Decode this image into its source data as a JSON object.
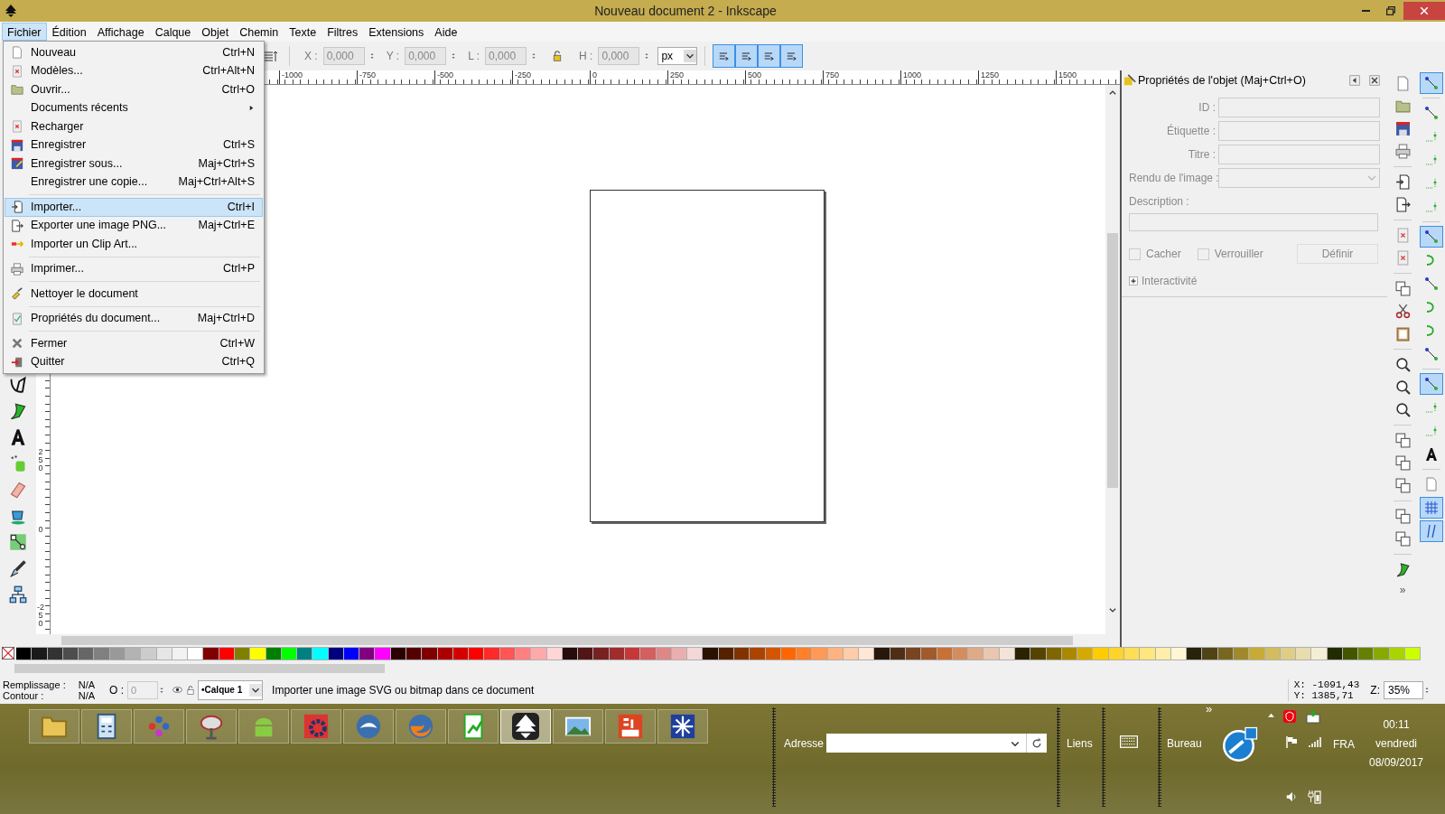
{
  "window": {
    "title": "Nouveau document 2 - Inkscape"
  },
  "menu_bar": [
    {
      "label": "Fichier",
      "selected": true
    },
    {
      "label": "Édition",
      "selected": false
    },
    {
      "label": "Affichage",
      "selected": false
    },
    {
      "label": "Calque",
      "selected": false
    },
    {
      "label": "Objet",
      "selected": false
    },
    {
      "label": "Chemin",
      "selected": false
    },
    {
      "label": "Texte",
      "selected": false
    },
    {
      "label": "Filtres",
      "selected": false
    },
    {
      "label": "Extensions",
      "selected": false
    },
    {
      "label": "Aide",
      "selected": false
    }
  ],
  "file_menu": [
    {
      "kind": "item",
      "label": "Nouveau",
      "shortcut": "Ctrl+N",
      "selected": false
    },
    {
      "kind": "item",
      "label": "Modèles...",
      "shortcut": "Ctrl+Alt+N",
      "selected": false
    },
    {
      "kind": "item",
      "label": "Ouvrir...",
      "shortcut": "Ctrl+O",
      "selected": false
    },
    {
      "kind": "submenu",
      "label": "Documents récents",
      "selected": false
    },
    {
      "kind": "item",
      "label": "Recharger",
      "selected": false
    },
    {
      "kind": "item",
      "label": "Enregistrer",
      "shortcut": "Ctrl+S",
      "selected": false
    },
    {
      "kind": "item",
      "label": "Enregistrer sous...",
      "shortcut": "Maj+Ctrl+S",
      "selected": false
    },
    {
      "kind": "item",
      "label": "Enregistrer une copie...",
      "shortcut": "Maj+Ctrl+Alt+S",
      "selected": false
    },
    {
      "kind": "separator"
    },
    {
      "kind": "item",
      "label": "Importer...",
      "shortcut": "Ctrl+I",
      "selected": true
    },
    {
      "kind": "item",
      "label": "Exporter une image PNG...",
      "shortcut": "Maj+Ctrl+E",
      "selected": false
    },
    {
      "kind": "item",
      "label": "Importer un Clip Art...",
      "selected": false
    },
    {
      "kind": "separator"
    },
    {
      "kind": "item",
      "label": "Imprimer...",
      "shortcut": "Ctrl+P",
      "selected": false
    },
    {
      "kind": "separator"
    },
    {
      "kind": "item",
      "label": "Nettoyer le document",
      "selected": false
    },
    {
      "kind": "separator"
    },
    {
      "kind": "item",
      "label": "Propriétés du document...",
      "shortcut": "Maj+Ctrl+D",
      "selected": false
    },
    {
      "kind": "separator"
    },
    {
      "kind": "item",
      "label": "Fermer",
      "shortcut": "Ctrl+W",
      "selected": false
    },
    {
      "kind": "item",
      "label": "Quitter",
      "shortcut": "Ctrl+Q",
      "selected": false
    }
  ],
  "toolbar": {
    "fields": [
      {
        "label": "X :",
        "value": "0,000"
      },
      {
        "label": "Y :",
        "value": "0,000"
      },
      {
        "label": "L :",
        "value": "0,000"
      },
      {
        "label": "H :",
        "value": "0,000"
      }
    ],
    "unit": "px",
    "toggles": [
      {
        "selected": true
      },
      {
        "selected": true
      },
      {
        "selected": true
      },
      {
        "selected": true
      }
    ]
  },
  "horizontal_ruler": [
    "-1000",
    "-750",
    "-500",
    "-250",
    "0",
    "250",
    "500",
    "750",
    "1000",
    "1250",
    "1500"
  ],
  "vertical_ruler": [
    "250",
    "0",
    "-250"
  ],
  "object_properties": {
    "title": "Propriétés de l'objet (Maj+Ctrl+O)",
    "disabled": true,
    "fields": [
      {
        "label": "ID :"
      },
      {
        "label": "Étiquette :"
      },
      {
        "label": "Titre :"
      }
    ],
    "render_label": "Rendu de l'image :",
    "description_label": "Description :",
    "checkboxes": [
      {
        "label": "Cacher",
        "checked": false
      },
      {
        "label": "Verrouiller",
        "checked": false
      }
    ],
    "button": "Définir",
    "expander": {
      "label": "Interactivité",
      "expanded": false
    }
  },
  "snap_bar": [
    {
      "selected": true
    },
    {
      "selected": false
    },
    {
      "selected": false
    },
    {
      "selected": false
    },
    {
      "selected": false
    },
    {
      "selected": false
    },
    {
      "selected": true
    },
    {
      "selected": false
    },
    {
      "selected": false
    },
    {
      "selected": false
    },
    {
      "selected": false
    },
    {
      "selected": false
    },
    {
      "selected": true
    },
    {
      "selected": false
    },
    {
      "selected": false
    },
    {
      "selected": false
    },
    {
      "selected": false
    },
    {
      "selected": true
    },
    {
      "selected": true
    }
  ],
  "commands_more": "»",
  "palette": [
    {
      "color": "#000000"
    },
    {
      "color": "#1a1a1a"
    },
    {
      "color": "#333333"
    },
    {
      "color": "#4d4d4d"
    },
    {
      "color": "#666666"
    },
    {
      "color": "#808080"
    },
    {
      "color": "#999999"
    },
    {
      "color": "#b3b3b3"
    },
    {
      "color": "#cccccc"
    },
    {
      "color": "#e6e6e6"
    },
    {
      "color": "#f2f2f2"
    },
    {
      "color": "#ffffff"
    },
    {
      "color": "#800000"
    },
    {
      "color": "#ff0000"
    },
    {
      "color": "#808000"
    },
    {
      "color": "#ffff00"
    },
    {
      "color": "#008000"
    },
    {
      "color": "#00ff00"
    },
    {
      "color": "#008080"
    },
    {
      "color": "#00ffff"
    },
    {
      "color": "#000080"
    },
    {
      "color": "#0000ff"
    },
    {
      "color": "#800080"
    },
    {
      "color": "#ff00ff"
    },
    {
      "color": "#2b0000"
    },
    {
      "color": "#550000"
    },
    {
      "color": "#800000"
    },
    {
      "color": "#aa0000"
    },
    {
      "color": "#d40000"
    },
    {
      "color": "#ff0000"
    },
    {
      "color": "#ff2a2a"
    },
    {
      "color": "#ff5555"
    },
    {
      "color": "#ff8080"
    },
    {
      "color": "#ffaaaa"
    },
    {
      "color": "#ffd5d5"
    },
    {
      "color": "#280b0b"
    },
    {
      "color": "#501616"
    },
    {
      "color": "#782121"
    },
    {
      "color": "#a02c2c"
    },
    {
      "color": "#c83737"
    },
    {
      "color": "#d35f5f"
    },
    {
      "color": "#de8787"
    },
    {
      "color": "#e9afaf"
    },
    {
      "color": "#f4d7d7"
    },
    {
      "color": "#2b1100"
    },
    {
      "color": "#552200"
    },
    {
      "color": "#803300"
    },
    {
      "color": "#aa4400"
    },
    {
      "color": "#d45500"
    },
    {
      "color": "#ff6600"
    },
    {
      "color": "#ff7f2a"
    },
    {
      "color": "#ff9955"
    },
    {
      "color": "#ffb380"
    },
    {
      "color": "#ffccaa"
    },
    {
      "color": "#ffe6d5"
    },
    {
      "color": "#28170b"
    },
    {
      "color": "#502d16"
    },
    {
      "color": "#784421"
    },
    {
      "color": "#a05a2c"
    },
    {
      "color": "#c87137"
    },
    {
      "color": "#d38d5f"
    },
    {
      "color": "#deaa87"
    },
    {
      "color": "#e9c6af"
    },
    {
      "color": "#f4e3d7"
    },
    {
      "color": "#2b2200"
    },
    {
      "color": "#554400"
    },
    {
      "color": "#806600"
    },
    {
      "color": "#aa8800"
    },
    {
      "color": "#d4aa00"
    },
    {
      "color": "#ffcc00"
    },
    {
      "color": "#ffd42a"
    },
    {
      "color": "#ffdd55"
    },
    {
      "color": "#ffe680"
    },
    {
      "color": "#ffeeaa"
    },
    {
      "color": "#fff6d5"
    },
    {
      "color": "#28220b"
    },
    {
      "color": "#504416"
    },
    {
      "color": "#786721"
    },
    {
      "color": "#a0892c"
    },
    {
      "color": "#c8ab37"
    },
    {
      "color": "#d3bc5f"
    },
    {
      "color": "#decd87"
    },
    {
      "color": "#e9ddaf"
    },
    {
      "color": "#f4eed7"
    },
    {
      "color": "#222b00"
    },
    {
      "color": "#445500"
    },
    {
      "color": "#668000"
    },
    {
      "color": "#88aa00"
    },
    {
      "color": "#aad400"
    },
    {
      "color": "#ccff00"
    }
  ],
  "status_bar": {
    "fill_label": "Remplissage :",
    "fill_value": "N/A",
    "stroke_label": "Contour :",
    "stroke_value": "N/A",
    "opacity_label": "O :",
    "opacity_value": "0",
    "layer": "•Calque 1",
    "message": "Importer une image SVG ou bitmap dans ce document",
    "x_reading": "X: -1091,43",
    "y_reading": "Y: 1385,71",
    "zoom_label": "Z:",
    "zoom_value": "35%"
  },
  "taskbar": {
    "apps": [
      {
        "selected": false
      },
      {
        "selected": false
      },
      {
        "selected": false
      },
      {
        "selected": false
      },
      {
        "selected": false
      },
      {
        "selected": false
      },
      {
        "selected": false
      },
      {
        "selected": false
      },
      {
        "selected": false
      },
      {
        "selected": true
      },
      {
        "selected": false
      },
      {
        "selected": false
      },
      {
        "selected": false
      }
    ],
    "more": "»",
    "address_label": "Adresse",
    "links_label": "Liens",
    "desktop_label": "Bureau",
    "language": "FRA",
    "time": "00:11",
    "day": "vendredi",
    "date": "08/09/2017"
  }
}
